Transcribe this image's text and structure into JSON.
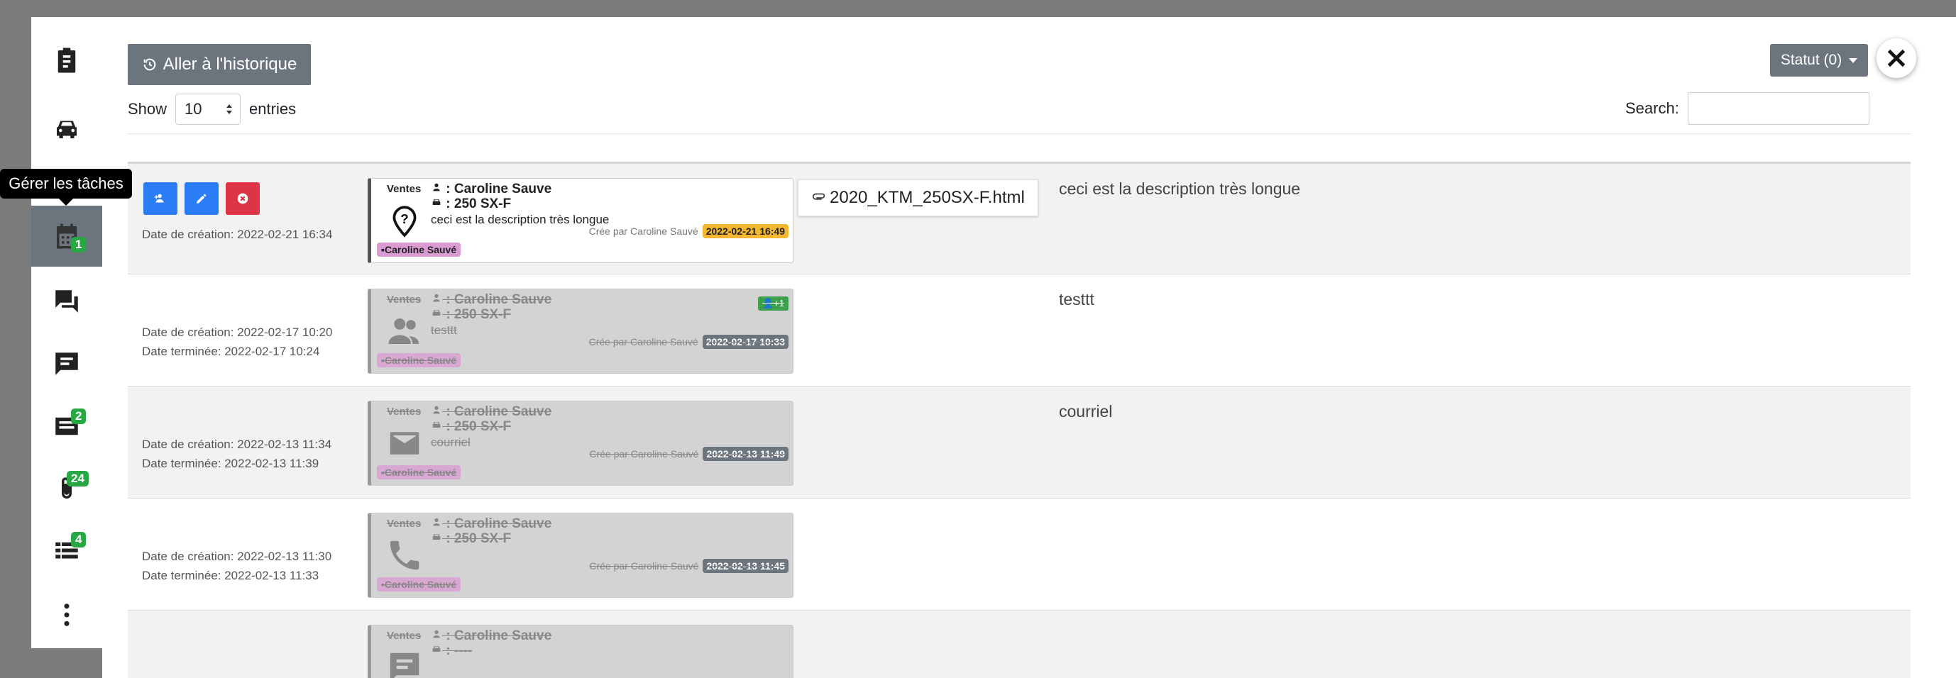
{
  "rail": {
    "tooltip": "Gérer les tâches",
    "items": [
      {
        "icon": "clipboard-icon",
        "badge": ""
      },
      {
        "icon": "car-icon",
        "badge": ""
      },
      {
        "icon": "calendar-icon",
        "badge": ""
      },
      {
        "icon": "calendar-tasks-icon",
        "badge": "1"
      },
      {
        "icon": "chat-icon",
        "badge": ""
      },
      {
        "icon": "message-list-icon",
        "badge": ""
      },
      {
        "icon": "notes-icon",
        "badge": "2"
      },
      {
        "icon": "paperclip-icon",
        "badge": "24"
      },
      {
        "icon": "list-icon",
        "badge": "4"
      },
      {
        "icon": "more-vertical-icon",
        "badge": ""
      }
    ]
  },
  "header": {
    "history_button": "Aller à l'historique",
    "status_button": "Statut (0)"
  },
  "table_controls": {
    "show_label": "Show",
    "entries_value": "10",
    "entries_label": "entries",
    "search_label": "Search:",
    "search_value": ""
  },
  "tasks": [
    {
      "created": "Date de création: 2022-02-21 16:34",
      "finished": "",
      "department": "Ventes",
      "client": ": Caroline Sauve",
      "vehicle": ": 250 SX-F",
      "text": "ceci est la description très longue",
      "created_by": "Crée par Caroline Sauvé",
      "date_badge": "2022-02-21 16:49",
      "owner": "Caroline Sauvé",
      "attachment": "2020_KTM_250SX-F.html",
      "description": "ceci est la description très longue",
      "icon": "location-question-icon",
      "done": false
    },
    {
      "created": "Date de création: 2022-02-17 10:20",
      "finished": "Date terminée: 2022-02-17 10:24",
      "department": "Ventes",
      "client": ": Caroline Sauve",
      "vehicle": ": 250 SX-F",
      "text": "testtt",
      "created_by": "Crée par Caroline Sauvé",
      "date_badge": "2022-02-17 10:33",
      "owner": "Caroline Sauvé",
      "participants_badge": "1",
      "description": "testtt",
      "icon": "people-icon",
      "done": true
    },
    {
      "created": "Date de création: 2022-02-13 11:34",
      "finished": "Date terminée: 2022-02-13 11:39",
      "department": "Ventes",
      "client": ": Caroline Sauve",
      "vehicle": ": 250 SX-F",
      "text": "courriel",
      "created_by": "Crée par Caroline Sauvé",
      "date_badge": "2022-02-13 11:49",
      "owner": "Caroline Sauvé",
      "description": "courriel",
      "icon": "envelope-icon",
      "done": true
    },
    {
      "created": "Date de création: 2022-02-13 11:30",
      "finished": "Date terminée: 2022-02-13 11:33",
      "department": "Ventes",
      "client": ": Caroline Sauve",
      "vehicle": ": 250 SX-F",
      "text": "",
      "created_by": "Crée par Caroline Sauvé",
      "date_badge": "2022-02-13 11:45",
      "owner": "Caroline Sauvé",
      "description": "",
      "icon": "phone-icon",
      "done": true
    },
    {
      "department": "Ventes",
      "client": ": Caroline Sauve",
      "vehicle": ": ----",
      "icon": "message-icon",
      "done": true
    }
  ]
}
